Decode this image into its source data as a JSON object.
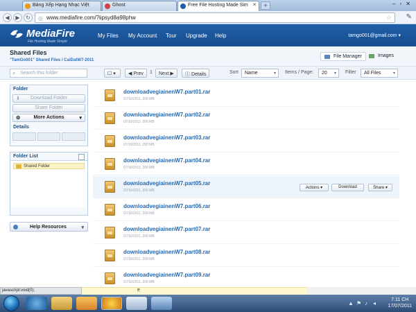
{
  "browser": {
    "tabs": [
      {
        "label": "Bảng Xếp Hạng Nhạc Việt"
      },
      {
        "label": "Ghost"
      },
      {
        "label": "Free File Hosting Made Sim"
      }
    ],
    "url": "www.mediafire.com/?iipsyd8a98phw",
    "back": "◀",
    "forward": "▶",
    "reload": "↻",
    "new_tab": "+",
    "window_controls": "–▫✕"
  },
  "header": {
    "brand": "MediaFire",
    "tagline": "File Hosting Made Simple",
    "nav": [
      "My Files",
      "My Account",
      "Tour",
      "Upgrade",
      "Help"
    ],
    "account": "tamgo001@gmail.com"
  },
  "titlebar": {
    "title": "Shared Files",
    "breadcrumb": "\"TamGo001\" Shared Files / CaiDatW7-2011",
    "views": [
      "File Manager",
      "Images"
    ]
  },
  "toolbar": {
    "search_placeholder": "Search this folder",
    "prev": "◀ Prev",
    "page": "1",
    "next": "Next ▶",
    "details": "Details",
    "sort_label": "Sort",
    "sort_value": "Name",
    "items_label": "Items / Page:",
    "items_value": "20",
    "filter_label": "Filter",
    "filter_value": "All Files"
  },
  "sidebar": {
    "folder_heading": "Folder",
    "download_folder": "Download Folder",
    "share_folder": "Share Folder",
    "more_actions": "More Actions",
    "details_heading": "Details",
    "folder_list_heading": "Folder List",
    "tree_item": "Shared Folder",
    "help_resources": "Help Resources"
  },
  "files": [
    {
      "name": "downloadvegiainenW7.part01.rar",
      "meta": "07/16/2011, 200 MB"
    },
    {
      "name": "downloadvegiainenW7.part02.rar",
      "meta": "07/16/2011, 200 MB"
    },
    {
      "name": "downloadvegiainenW7.part03.rar",
      "meta": "07/16/2011, 200 MB"
    },
    {
      "name": "downloadvegiainenW7.part04.rar",
      "meta": "07/16/2011, 200 MB"
    },
    {
      "name": "downloadvegiainenW7.part05.rar",
      "meta": "07/16/2011, 200 MB"
    },
    {
      "name": "downloadvegiainenW7.part06.rar",
      "meta": "07/16/2011, 200 MB"
    },
    {
      "name": "downloadvegiainenW7.part07.rar",
      "meta": "07/16/2011, 200 MB"
    },
    {
      "name": "downloadvegiainenW7.part08.rar",
      "meta": "07/16/2011, 200 MB"
    },
    {
      "name": "downloadvegiainenW7.part09.rar",
      "meta": "07/16/2011, 200 MB"
    }
  ],
  "row_actions": {
    "actions": "Actions ▾",
    "download": "Download",
    "share": "Share ▾"
  },
  "status": {
    "link": "javascript:void(0);",
    "notice": "e"
  },
  "taskbar": {
    "time": "7:11 CH",
    "date": "17/07/2011"
  },
  "colors": {
    "brand_blue": "#1f5fa8",
    "link_blue": "#2569b1"
  }
}
